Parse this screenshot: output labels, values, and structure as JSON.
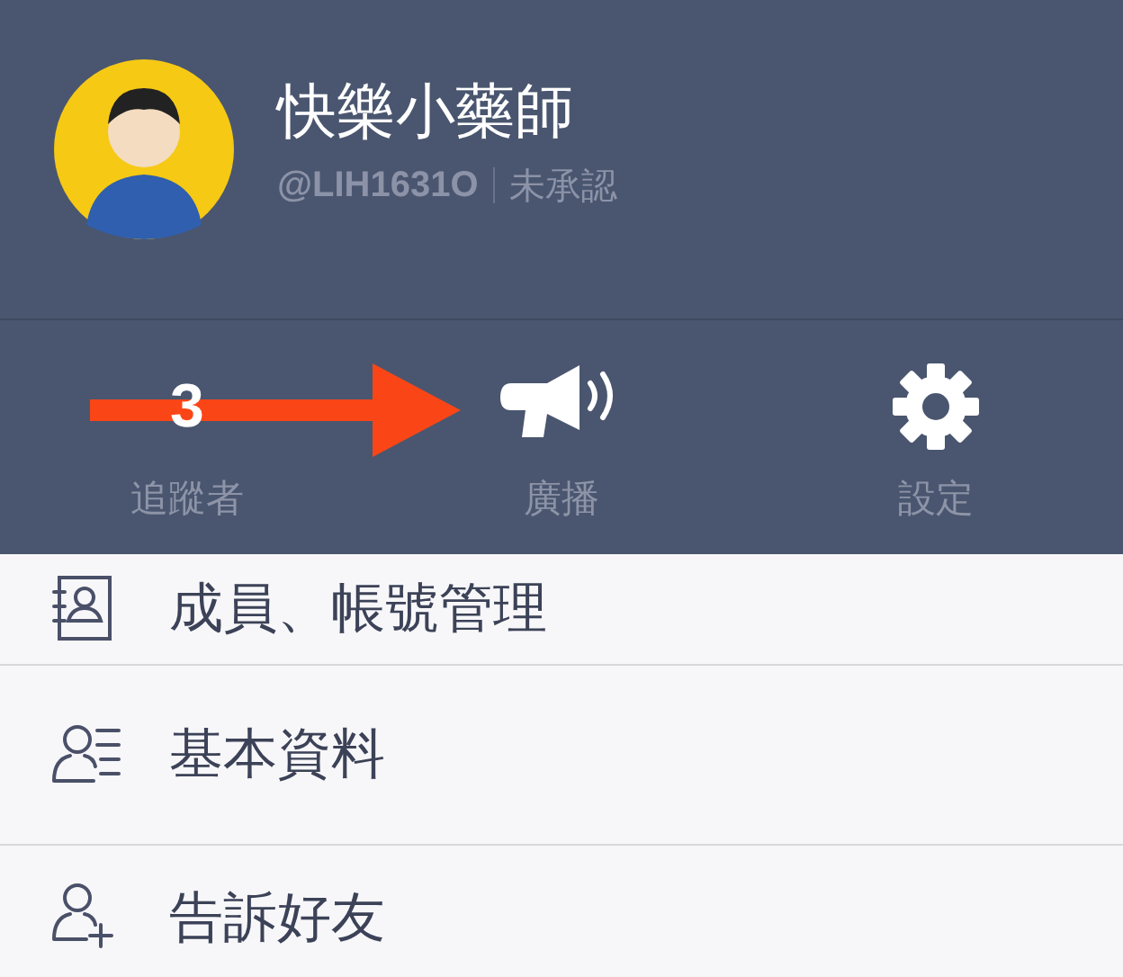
{
  "profile": {
    "name": "快樂小藥師",
    "handle": "@LIH1631O",
    "status": "未承認"
  },
  "stats": [
    {
      "kind": "count",
      "value": "3",
      "label": "追蹤者"
    },
    {
      "kind": "megaphone",
      "label": "廣播"
    },
    {
      "kind": "gear",
      "label": "設定"
    }
  ],
  "menu": [
    {
      "kind": "members",
      "label": "成員、帳號管理"
    },
    {
      "kind": "profile",
      "label": "基本資料"
    },
    {
      "kind": "invite",
      "label": "告訴好友"
    }
  ]
}
